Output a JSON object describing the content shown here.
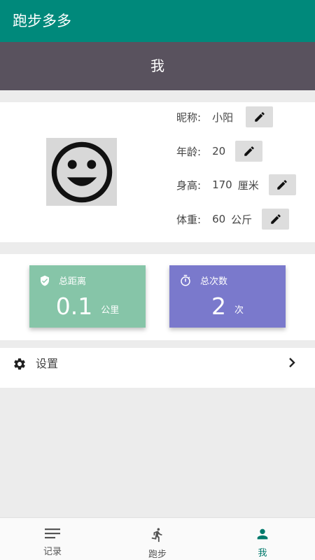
{
  "app": {
    "title": "跑步多多"
  },
  "header": {
    "title": "我"
  },
  "profile": {
    "nickname_label": "昵称:",
    "nickname": "小阳",
    "age_label": "年龄:",
    "age": "20",
    "height_label": "身高:",
    "height": "170",
    "height_unit": "厘米",
    "weight_label": "体重:",
    "weight": "60",
    "weight_unit": "公斤",
    "avatar_icon": "smiley-face-icon",
    "edit_icon": "pencil-icon"
  },
  "stats": {
    "distance": {
      "label": "总距离",
      "value": "0.1",
      "unit": "公里",
      "color": "#86c5a8",
      "icon": "shield-check-icon"
    },
    "count": {
      "label": "总次数",
      "value": "2",
      "unit": "次",
      "color": "#7a79cc",
      "icon": "stopwatch-icon"
    }
  },
  "settings": {
    "label": "设置",
    "icon": "gear-icon"
  },
  "nav": {
    "items": [
      {
        "label": "记录",
        "icon": "list-icon"
      },
      {
        "label": "跑步",
        "icon": "runner-icon"
      },
      {
        "label": "我",
        "icon": "person-icon"
      }
    ],
    "active_color": "#00796b"
  },
  "colors": {
    "appbar": "#00897b",
    "subheader": "#59525e"
  }
}
